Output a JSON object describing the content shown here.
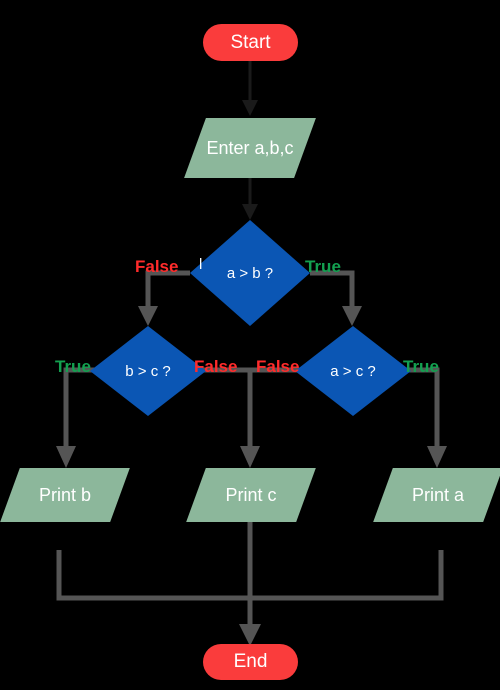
{
  "diagram": {
    "title": "Largest of three numbers flowchart",
    "colors": {
      "background": "#000000",
      "terminator": "#fa3c3c",
      "io": "#8cb79b",
      "decision": "#0b56b4",
      "connector_gray": "#555555",
      "connector_dark": "#1a1a1a",
      "label_true": "#13a050",
      "label_false": "#ff2b2b",
      "node_text": "#ffffff"
    },
    "nodes": {
      "start": "Start",
      "input": "Enter a,b,c",
      "decision_ab": "a > b ?",
      "decision_bc": "b > c ?",
      "decision_ac": "a > c ?",
      "print_b": "Print b",
      "print_c": "Print c",
      "print_a": "Print a",
      "end": "End"
    },
    "edge_labels": {
      "ab_false": "False",
      "ab_true": "True",
      "bc_true": "True",
      "bc_false": "False",
      "ac_false": "False",
      "ac_true": "True"
    }
  }
}
